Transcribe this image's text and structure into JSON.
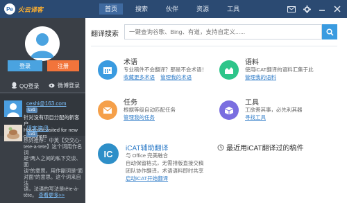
{
  "app": {
    "logo_badge": "Pe",
    "name": "火云译客"
  },
  "nav": {
    "items": [
      {
        "label": "首页",
        "active": true
      },
      {
        "label": "搜索",
        "active": false
      },
      {
        "label": "伙伴",
        "active": false
      },
      {
        "label": "资源",
        "active": false
      },
      {
        "label": "工具",
        "active": false
      }
    ]
  },
  "window_controls": [
    "mail-icon",
    "gear-icon",
    "minimize-icon",
    "close-icon"
  ],
  "sidebar": {
    "login_label": "登录",
    "register_label": "注册",
    "qq_login": "QQ登录",
    "weibo_login": "微博登录",
    "user": {
      "email": "ceshi@163.com",
      "level": "Lv1",
      "message_line1": "针对没有项目分配的新客户",
      "message_line2": "Have not visited for new",
      "message_line3": "customers"
    },
    "news": {
      "title": "译客资讯",
      "level": "Lv1",
      "body_line1": "热词推荐：中英【交交心-",
      "body_line2": "tete-a-tete】这个词用作名词",
      "body_line3": "是“两人之间的私下交谈、面",
      "body_line4": "谈”的意思，用作副词是“面",
      "body_line5": "对面”的意思。这个词来自法",
      "body_line6": "语，法语的写法是tête-à-",
      "body_line7": "tête。",
      "more": "查看更多>>"
    }
  },
  "search": {
    "label": "翻译搜索",
    "placeholder": "一键查询谷歌、Bing、有道，支持自定义......"
  },
  "features": {
    "terms": {
      "title": "术语",
      "desc": "专业稿件不会翻译？那是不会术语！",
      "link1": "收藏更多术语",
      "link2": "管理我的术语"
    },
    "corpus": {
      "title": "语料",
      "desc": "使用iCAT翻译的语料汇集于此",
      "link1": "管理我的语料"
    },
    "tasks": {
      "title": "任务",
      "desc": "根据等级自动匹配任务",
      "link1": "管理我的任务"
    },
    "tools": {
      "title": "工具",
      "desc": "工欲善其事，必先利其器",
      "link1": "寻找工具"
    }
  },
  "icat": {
    "badge": "IC",
    "title": "iCAT辅助翻译",
    "line1": "与 Office 完美融合",
    "line2": "自动保留格式，无需排版直接交稿",
    "line3": "团队协作翻译，术语语料即时共享",
    "link": "启动iCAT开始翻译"
  },
  "recent": {
    "title": "最近用iCAT翻译过的稿件"
  },
  "colors": {
    "topbar": "#2b4a72",
    "sidebar": "#3a3f46",
    "accent_blue": "#3a9be0",
    "accent_orange": "#f2743b",
    "terms": "#3a9be0",
    "corpus": "#2ec58a",
    "tasks": "#f5a04a",
    "tools": "#7a6ee0",
    "icat": "#2e8fc8"
  }
}
